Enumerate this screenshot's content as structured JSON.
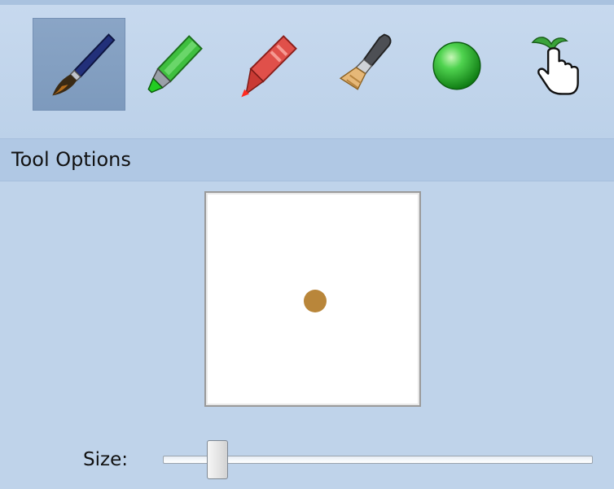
{
  "toolbar": {
    "tools": [
      {
        "icon": "paintbrush-icon",
        "selected": true
      },
      {
        "icon": "highlighter-icon",
        "selected": false
      },
      {
        "icon": "crayon-icon",
        "selected": false
      },
      {
        "icon": "flat-brush-icon",
        "selected": false
      },
      {
        "icon": "green-ball-icon",
        "selected": false
      },
      {
        "icon": "hand-pointer-icon",
        "selected": false
      }
    ]
  },
  "panel": {
    "title": "Tool Options",
    "preview": {
      "dot_color": "#b9863a"
    },
    "size": {
      "label": "Size:",
      "value_fraction": 0.13
    }
  },
  "colors": {
    "background": "#bfd3ea",
    "header": "#b0c8e4",
    "selected_tool": "#7d9abd"
  }
}
